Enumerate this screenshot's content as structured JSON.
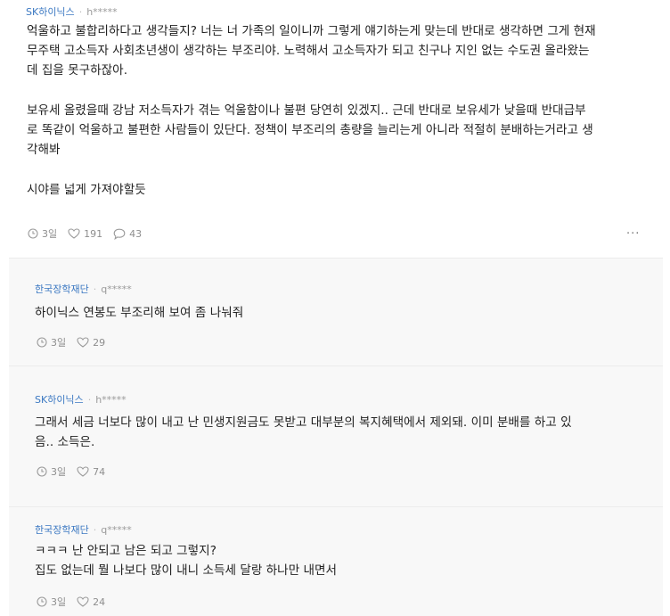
{
  "post": {
    "company": "SK하이닉스",
    "user": "h*****",
    "paragraphs": [
      [
        "억울하고 불합리하다고 생각들지? 너는 너 가족의 일이니까 그렇게 얘기하는게 맞는데 반대로 생각하면 그게 현재",
        "무주택 고소득자 사회초년생이 생각하는 부조리야. 노력해서 고소득자가 되고 친구나 지인 없는 수도권 올라왔는",
        "데 집을 못구하잖아."
      ],
      [
        "보유세 올렸을때 강남 저소득자가 겪는 억울함이나 불편 당연히 있겠지.. 근데 반대로 보유세가 낮을때 반대급부",
        "로 똑같이 억울하고 불편한 사람들이 있단다. 정책이 부조리의 총량을 늘리는게 아니라 적절히 분배하는거라고 생",
        "각해봐"
      ],
      [
        "시야를 넓게 가져야할듯"
      ]
    ],
    "time": "3일",
    "likes": "191",
    "comments": "43",
    "more_label": "···"
  },
  "replies": [
    {
      "company": "한국장학재단",
      "user": "q*****",
      "lines": [
        "하이닉스 연봉도 부조리해 보여 좀 나눠줘"
      ],
      "time": "3일",
      "likes": "29"
    },
    {
      "company": "SK하이닉스",
      "user": "h*****",
      "lines": [
        "그래서 세금 너보다 많이 내고 난 민생지원금도 못받고 대부분의 복지혜택에서 제외돼. 이미 분배를 하고 있",
        "음.. 소득은."
      ],
      "time": "3일",
      "likes": "74"
    },
    {
      "company": "한국장학재단",
      "user": "q*****",
      "lines": [
        "ㅋㅋㅋ 난 안되고 남은 되고 그렇지?",
        "집도 없는데 뭘 나보다 많이 내니 소득세 달랑 하나만 내면서"
      ],
      "time": "3일",
      "likes": "24"
    }
  ],
  "colors": {
    "company": "#3b78c2",
    "meta": "#9a9a9a",
    "text": "#222222",
    "reply_bg": "#f8f8f8"
  },
  "icons": {
    "time": "clock-icon",
    "likes": "heart-icon",
    "comments": "speech-bubble-icon",
    "more": "more-dots-icon"
  }
}
